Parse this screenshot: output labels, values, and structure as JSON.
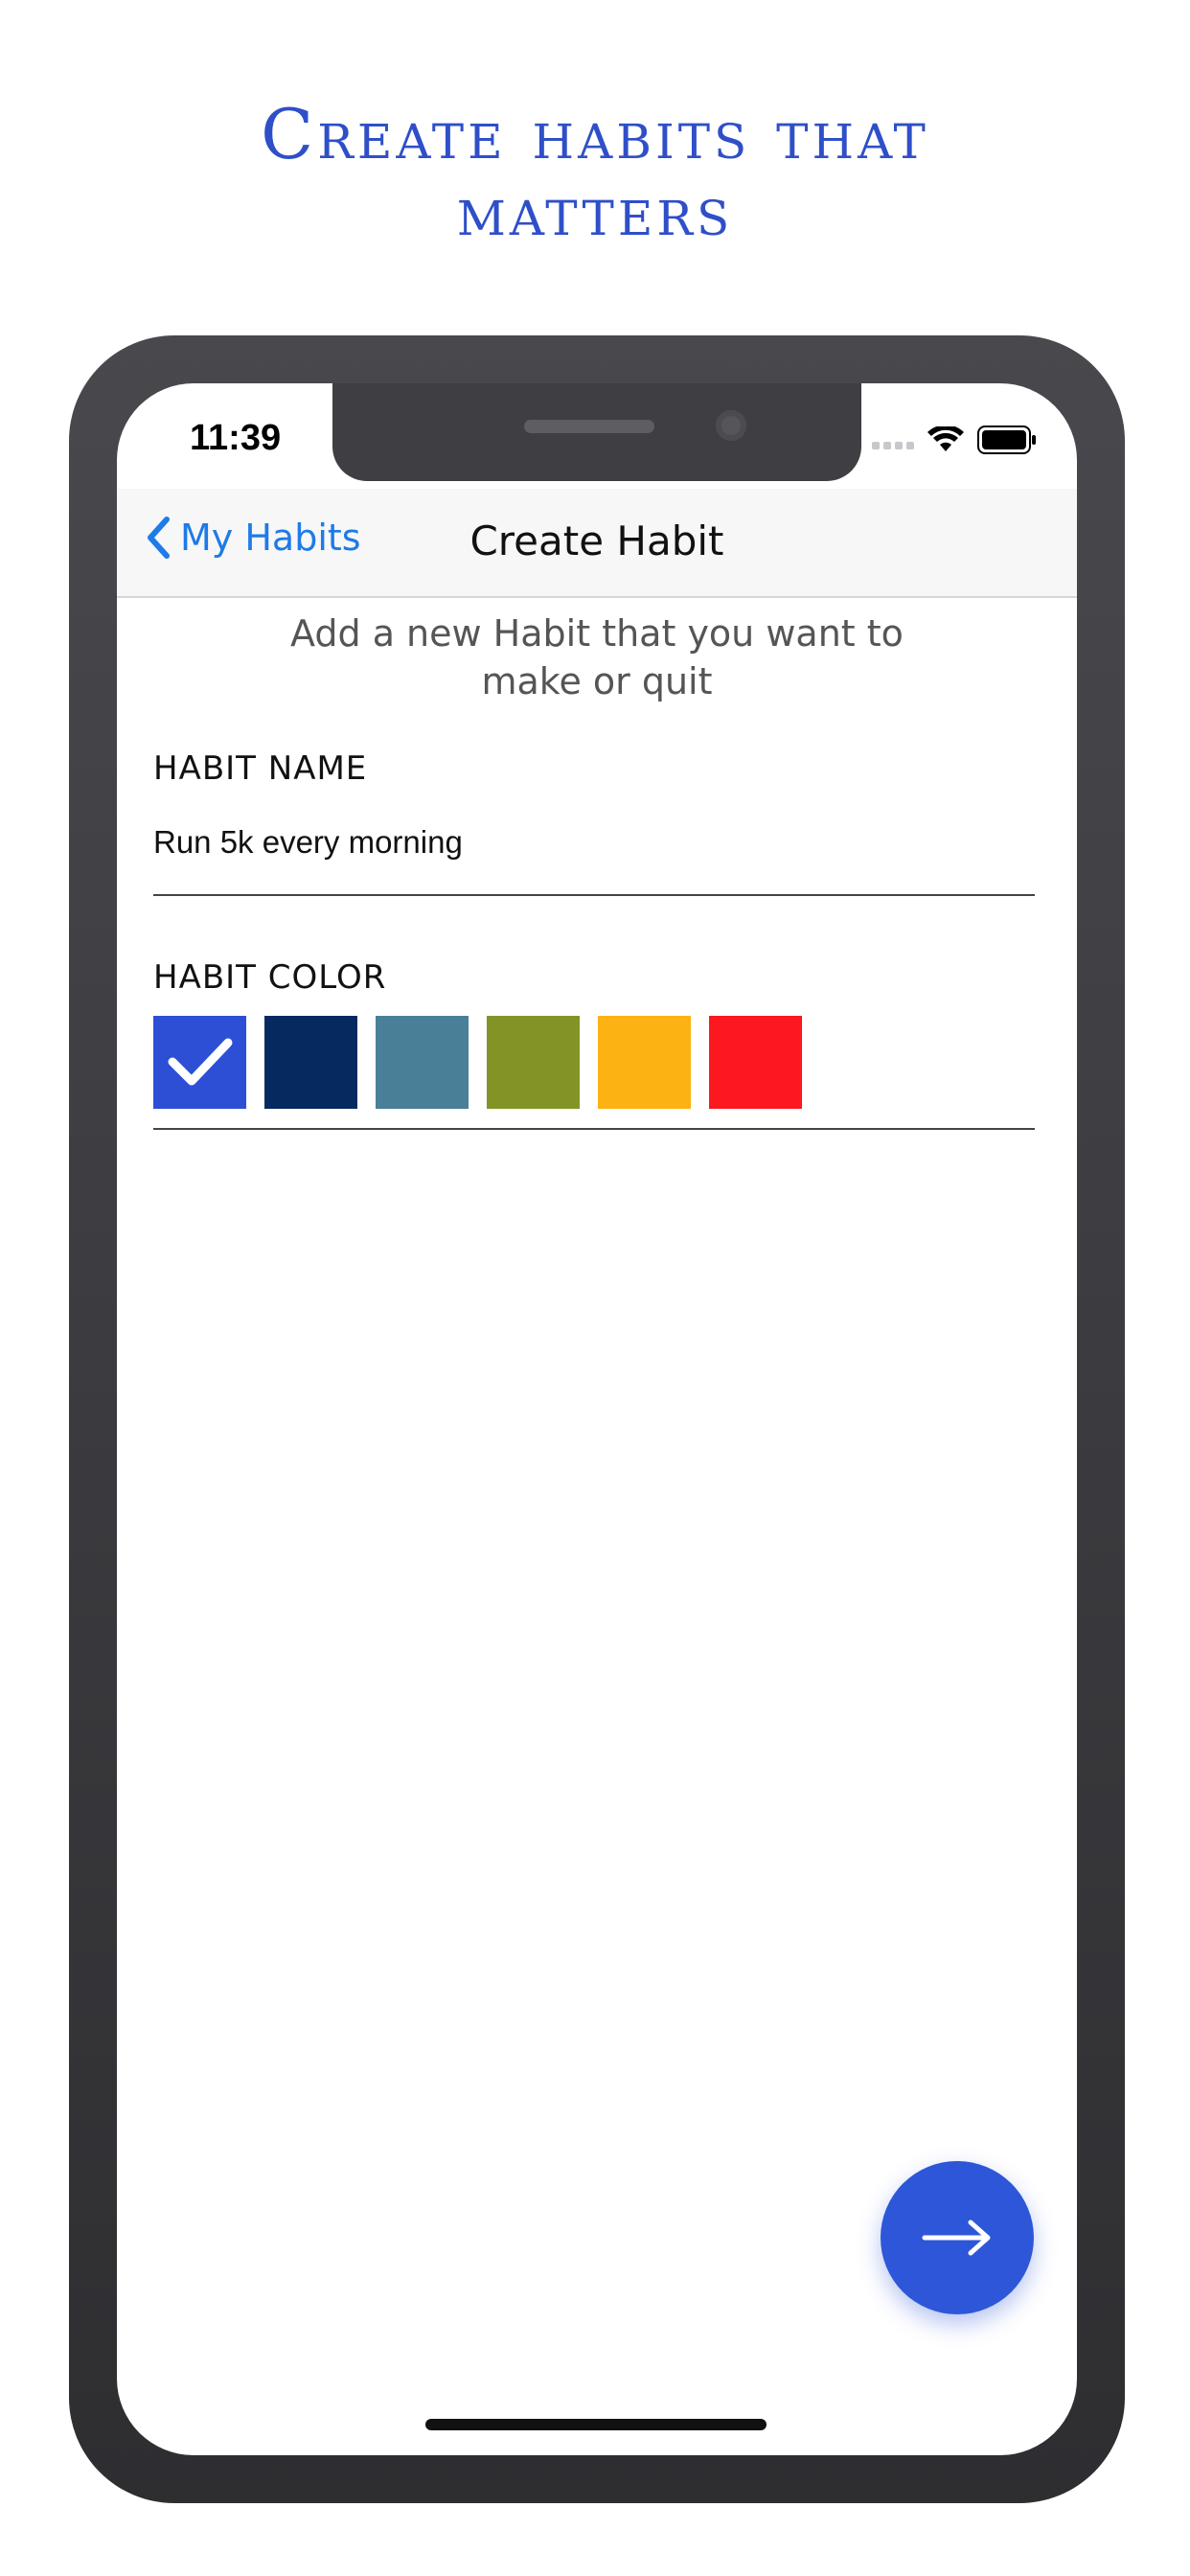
{
  "headline": {
    "line1": "Create habits that",
    "line2": "matters"
  },
  "status_bar": {
    "time": "11:39",
    "icons": [
      "signal-dots-icon",
      "wifi-icon",
      "battery-icon"
    ]
  },
  "navbar": {
    "back_label": "My Habits",
    "back_icon": "chevron-left-icon",
    "title": "Create Habit"
  },
  "form": {
    "subtitle_line1": "Add a new Habit that you want to",
    "subtitle_line2": "make or quit",
    "name_label": "HABIT NAME",
    "name_value": "Run 5k every morning",
    "color_label": "HABIT COLOR",
    "colors": [
      {
        "hex": "#2d4fd6",
        "selected": true
      },
      {
        "hex": "#062a60",
        "selected": false
      },
      {
        "hex": "#4a7f98",
        "selected": false
      },
      {
        "hex": "#849326",
        "selected": false
      },
      {
        "hex": "#fdb213",
        "selected": false
      },
      {
        "hex": "#fd1720",
        "selected": false
      }
    ]
  },
  "next_button": {
    "icon": "arrow-right-icon"
  },
  "theme": {
    "accent": "#2d57d8",
    "link": "#1e7be7",
    "headline": "#2f4fc9"
  }
}
